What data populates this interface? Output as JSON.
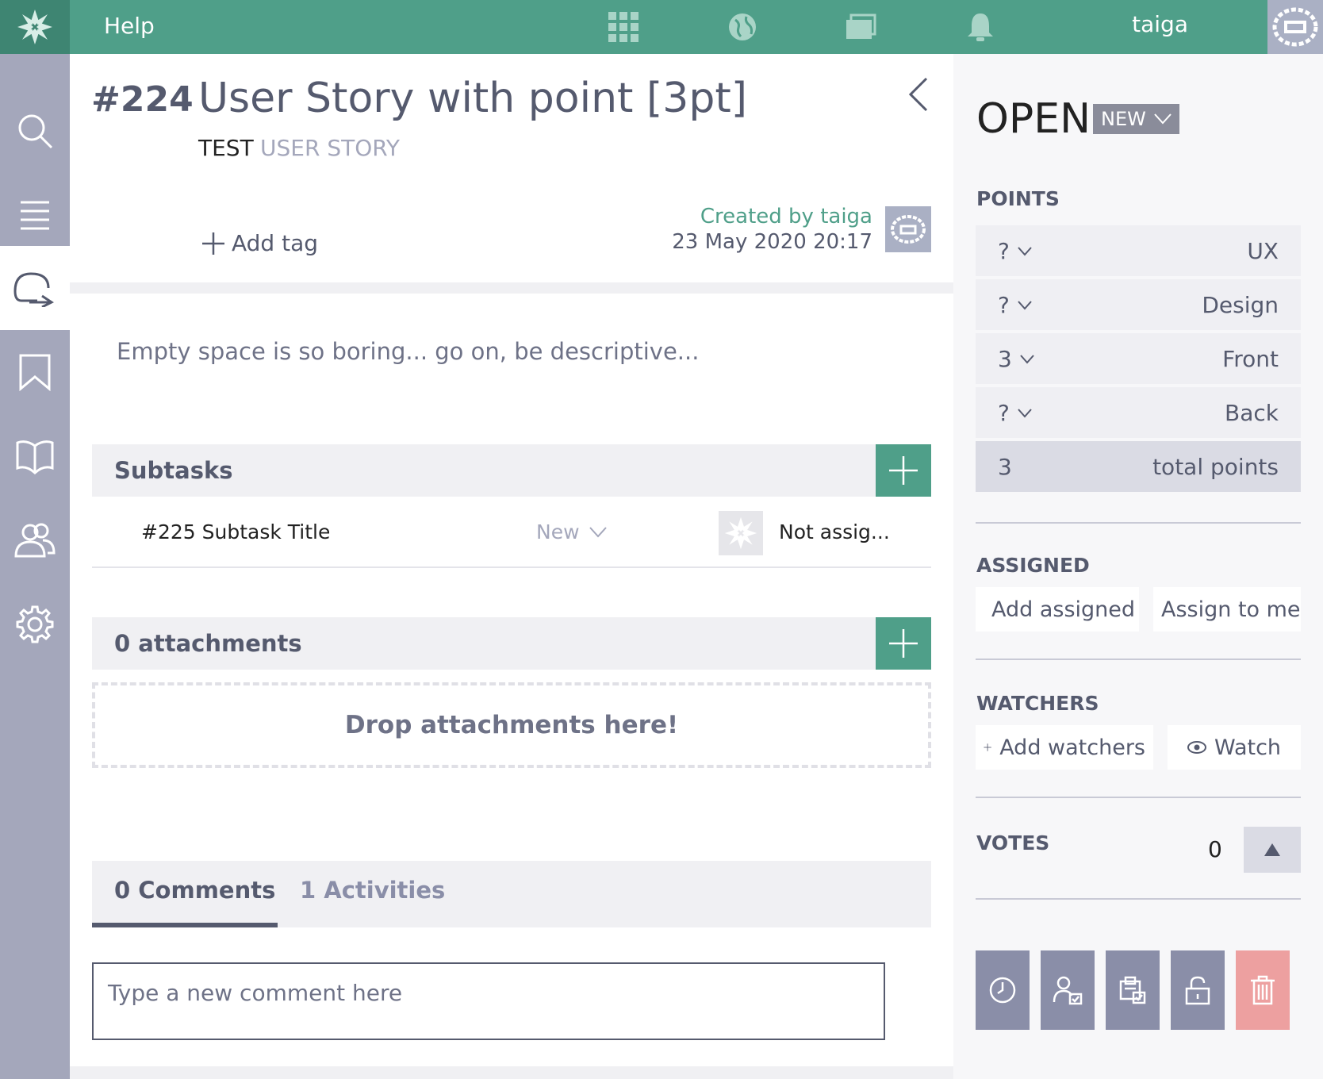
{
  "topbar": {
    "help_label": "Help",
    "username": "taiga",
    "icons": [
      "logo-icon",
      "projects-grid-icon",
      "discover-globe-icon",
      "folder-icon",
      "notifications-bell-icon",
      "user-avatar-icon"
    ]
  },
  "sidebar": {
    "items": [
      "search-icon",
      "backlog-icon",
      "kanban-icon",
      "epics-icon",
      "wiki-icon",
      "team-icon",
      "settings-icon"
    ],
    "active": "kanban-icon"
  },
  "story": {
    "ref": "#224",
    "title": "User Story with point [3pt]",
    "project": "TEST",
    "type": "USER STORY",
    "add_tag": "Add tag",
    "created_by": "Created by taiga",
    "created_date": "23 May 2020 20:17",
    "description_placeholder": "Empty space is so boring... go on, be descriptive..."
  },
  "subtasks": {
    "title": "Subtasks",
    "items": [
      {
        "title": "#225 Subtask Title",
        "status": "New",
        "assignee": "Not assig..."
      }
    ]
  },
  "attachments": {
    "title": "0 attachments",
    "drop_text": "Drop attachments here!"
  },
  "tabs": {
    "comments": "0 Comments",
    "activities": "1 Activities",
    "comment_placeholder": "Type a new comment here"
  },
  "sidebar_right": {
    "status": "OPEN",
    "status_badge": "NEW",
    "points_label": "POINTS",
    "points": [
      {
        "value": "?",
        "role": "UX"
      },
      {
        "value": "?",
        "role": "Design"
      },
      {
        "value": "3",
        "role": "Front"
      },
      {
        "value": "?",
        "role": "Back"
      }
    ],
    "total_value": "3",
    "total_label": "total points",
    "assigned_label": "ASSIGNED",
    "add_assigned": "Add assigned",
    "assign_to_me": "Assign to me",
    "watchers_label": "WATCHERS",
    "add_watchers": "Add watchers",
    "watch": "Watch",
    "votes_label": "VOTES",
    "votes_count": "0"
  },
  "colors": {
    "accent": "#4f9f89",
    "sidebar": "#a4a7bb",
    "text": "#555a6e",
    "danger": "#eda0a0"
  }
}
